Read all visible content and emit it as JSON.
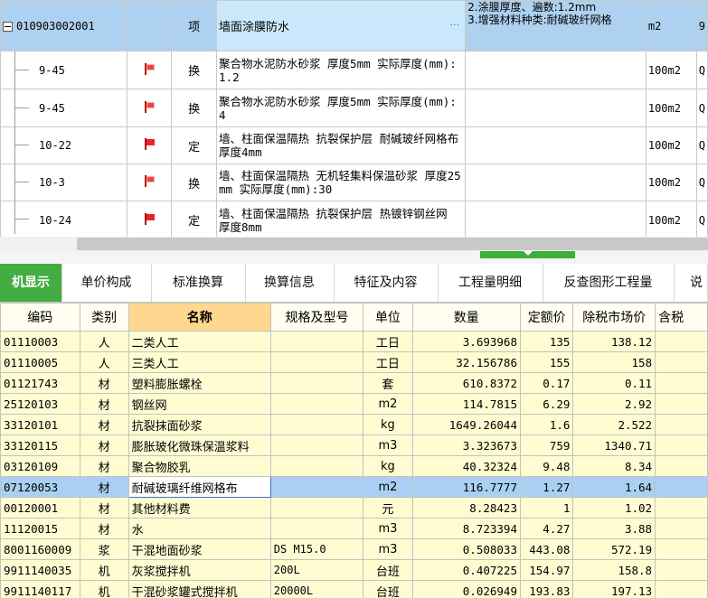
{
  "top": {
    "header_row": {
      "code": "010903002001",
      "type": "项",
      "name": "墙面涂膜防水",
      "ellipsis": "···",
      "features_line1": "2.涂膜厚度、遍数:1.2mm",
      "features_line2": "3.增强材料种类:耐碱玻纤网格",
      "unit": "m2",
      "extra": "9"
    },
    "rows": [
      {
        "code": "9-45",
        "flag": "换",
        "name": "聚合物水泥防水砂浆 厚度5mm  实际厚度(mm):1.2",
        "unit": "100m2",
        "extra": "Q"
      },
      {
        "code": "9-45",
        "flag": "换",
        "name": "聚合物水泥防水砂浆 厚度5mm  实际厚度(mm):4",
        "unit": "100m2",
        "extra": "Q"
      },
      {
        "code": "10-22",
        "flag": "定",
        "name": "墙、柱面保温隔热 抗裂保护层 耐碱玻纤网格布 厚度4mm",
        "unit": "100m2",
        "extra": "Q"
      },
      {
        "code": "10-3",
        "flag": "换",
        "name": "墙、柱面保温隔热 无机轻集料保温砂浆 厚度25mm  实际厚度(mm):30",
        "unit": "100m2",
        "extra": "Q"
      },
      {
        "code": "10-24",
        "flag": "定",
        "name": "墙、柱面保温隔热 抗裂保护层 热镀锌钢丝网 厚度8mm",
        "unit": "100m2",
        "extra": "Q"
      }
    ]
  },
  "tabs": [
    "机显示",
    "单价构成",
    "标准换算",
    "换算信息",
    "特征及内容",
    "工程量明细",
    "反查图形工程量",
    "说"
  ],
  "bottom": {
    "headers": {
      "code": "编码",
      "category": "类别",
      "name": "名称",
      "spec": "规格及型号",
      "unit": "单位",
      "qty": "数量",
      "quota_price": "定额价",
      "market_price": "除税市场价",
      "tax": "含税"
    },
    "rows": [
      {
        "code": "01110003",
        "category": "人",
        "name": "二类人工",
        "spec": "",
        "unit": "工日",
        "qty": "3.693968",
        "quota_price": "135",
        "market_price": "138.12"
      },
      {
        "code": "01110005",
        "category": "人",
        "name": "三类人工",
        "spec": "",
        "unit": "工日",
        "qty": "32.156786",
        "quota_price": "155",
        "market_price": "158"
      },
      {
        "code": "01121743",
        "category": "材",
        "name": "塑料膨胀螺栓",
        "spec": "",
        "unit": "套",
        "qty": "610.8372",
        "quota_price": "0.17",
        "market_price": "0.11"
      },
      {
        "code": "25120103",
        "category": "材",
        "name": "钢丝网",
        "spec": "",
        "unit": "m2",
        "qty": "114.7815",
        "quota_price": "6.29",
        "market_price": "2.92"
      },
      {
        "code": "33120101",
        "category": "材",
        "name": "抗裂抹面砂浆",
        "spec": "",
        "unit": "kg",
        "qty": "1649.26044",
        "quota_price": "1.6",
        "market_price": "2.522"
      },
      {
        "code": "33120115",
        "category": "材",
        "name": "膨胀玻化微珠保温浆料",
        "spec": "",
        "unit": "m3",
        "qty": "3.323673",
        "quota_price": "759",
        "market_price": "1340.71"
      },
      {
        "code": "03120109",
        "category": "材",
        "name": "聚合物胶乳",
        "spec": "",
        "unit": "kg",
        "qty": "40.32324",
        "quota_price": "9.48",
        "market_price": "8.34"
      },
      {
        "code": "07120053",
        "category": "材",
        "name": "耐碱玻璃纤维网格布",
        "spec": "",
        "unit": "m2",
        "qty": "116.7777",
        "quota_price": "1.27",
        "market_price": "1.64"
      },
      {
        "code": "00120001",
        "category": "材",
        "name": "其他材料费",
        "spec": "",
        "unit": "元",
        "qty": "8.28423",
        "quota_price": "1",
        "market_price": "1.02"
      },
      {
        "code": "11120015",
        "category": "材",
        "name": "水",
        "spec": "",
        "unit": "m3",
        "qty": "8.723394",
        "quota_price": "4.27",
        "market_price": "3.88"
      },
      {
        "code": "8001160009",
        "category": "浆",
        "name": "干混地面砂浆",
        "spec": "DS M15.0",
        "unit": "m3",
        "qty": "0.508033",
        "quota_price": "443.08",
        "market_price": "572.19"
      },
      {
        "code": "9911140035",
        "category": "机",
        "name": "灰浆搅拌机",
        "spec": "200L",
        "unit": "台班",
        "qty": "0.407225",
        "quota_price": "154.97",
        "market_price": "158.8"
      },
      {
        "code": "9911140117",
        "category": "机",
        "name": "干混砂浆罐式搅拌机",
        "spec": "20000L",
        "unit": "台班",
        "qty": "0.026949",
        "quota_price": "193.83",
        "market_price": "197.13"
      }
    ]
  },
  "colors": {
    "tab_active": "#43ac43",
    "row_yellow": "#fffcd2",
    "row_selected": "#a9d0f2",
    "header_row_blue": "#aed1ef"
  }
}
